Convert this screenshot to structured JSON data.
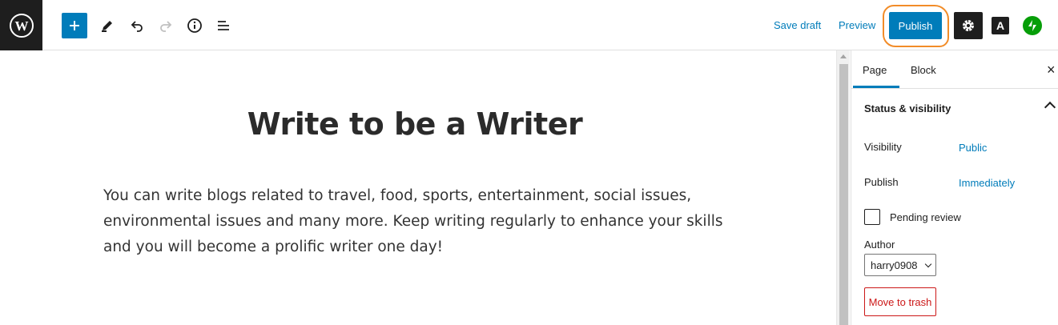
{
  "toolbar": {
    "save_draft_label": "Save draft",
    "preview_label": "Preview",
    "publish_label": "Publish",
    "a_label": "A"
  },
  "post": {
    "title": "Write to be a Writer",
    "body": "You can write blogs related to travel, food, sports, entertainment, social issues, environmental issues and many more. Keep writing regularly to enhance your skills and you will become a prolific writer one day!"
  },
  "sidebar": {
    "tabs": [
      {
        "label": "Page"
      },
      {
        "label": "Block"
      }
    ],
    "close_icon": "×",
    "panel_title": "Status & visibility",
    "visibility_label": "Visibility",
    "visibility_value": "Public",
    "publish_label": "Publish",
    "publish_value": "Immediately",
    "pending_review_label": "Pending review",
    "author_label": "Author",
    "author_value": "harry0908",
    "trash_label": "Move to trash"
  },
  "colors": {
    "accent": "#007cba",
    "highlight_ring": "#f28c28",
    "danger": "#cc1818",
    "jetpack": "#069e08"
  }
}
